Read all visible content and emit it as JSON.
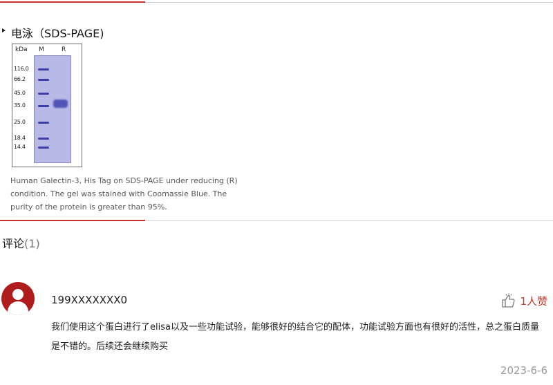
{
  "section": {
    "title": "电泳（SDS-PAGE)"
  },
  "gel": {
    "unit_label": "kDa",
    "lane_m": "M",
    "lane_r": "R",
    "markers": [
      "116.0",
      "66.2",
      "45.0",
      "35.0",
      "25.0",
      "18.4",
      "14.4"
    ]
  },
  "caption": "Human Galectin-3, His Tag on SDS-PAGE under reducing (R) condition. The gel was stained with Coomassie Blue. The purity of the protein is greater than 95%.",
  "comments": {
    "title": "评论",
    "count": "(1)",
    "items": [
      {
        "user": "199XXXXXXX0",
        "likes": "1人赞",
        "text": "我们使用这个蛋白进行了elisa以及一些功能试验，能够很好的结合它的配体，功能试验方面也有很好的活性，总之蛋白质量是不错的。后续还会继续购买",
        "date": "2023-6-6"
      }
    ]
  },
  "colors": {
    "accent": "#c9302c",
    "avatar": "#b01c1c",
    "like": "#c0392b",
    "gel_lane": "#b8b9e6",
    "gel_band": "#3b3fa3"
  },
  "icons": {
    "avatar": "user-avatar-icon",
    "like": "thumbs-up-icon",
    "bullet": "triangle-bullet-icon"
  }
}
